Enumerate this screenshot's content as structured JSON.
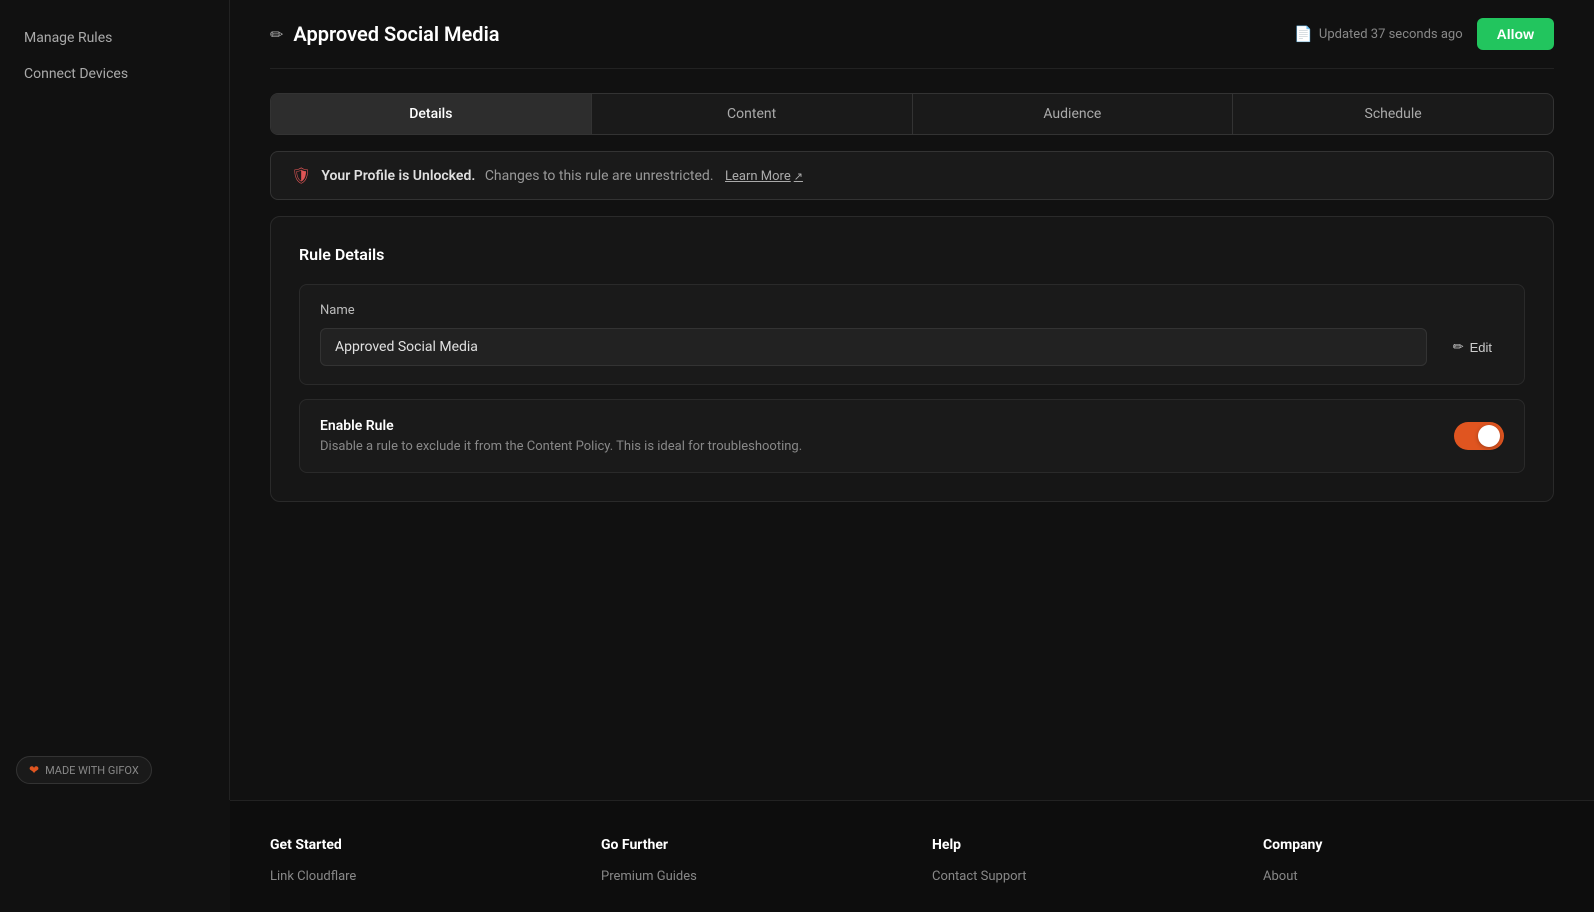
{
  "sidebar": {
    "items": [
      {
        "label": "Manage Rules",
        "id": "manage-rules"
      },
      {
        "label": "Connect Devices",
        "id": "connect-devices"
      }
    ]
  },
  "header": {
    "title": "Approved Social Media",
    "edit_icon": "✏",
    "updated_text": "Updated 37 seconds ago",
    "doc_icon": "📄",
    "allow_button_label": "Allow"
  },
  "tabs": [
    {
      "label": "Details",
      "active": true
    },
    {
      "label": "Content",
      "active": false
    },
    {
      "label": "Audience",
      "active": false
    },
    {
      "label": "Schedule",
      "active": false
    }
  ],
  "banner": {
    "icon": "🛡",
    "bold_text": "Your Profile is Unlocked.",
    "sub_text": "Changes to this rule are unrestricted.",
    "learn_more_label": "Learn More",
    "ext_icon": "↗"
  },
  "rule_details": {
    "section_title": "Rule Details",
    "name_label": "Name",
    "name_value": "Approved Social Media",
    "edit_label": "Edit",
    "edit_icon": "✏",
    "enable_rule_title": "Enable Rule",
    "enable_rule_desc": "Disable a rule to exclude it from the Content Policy. This is ideal for troubleshooting.",
    "toggle_enabled": true
  },
  "footer": {
    "columns": [
      {
        "title": "Get Started",
        "links": [
          "Link Cloudflare"
        ]
      },
      {
        "title": "Go Further",
        "links": [
          "Premium Guides"
        ]
      },
      {
        "title": "Help",
        "links": [
          "Contact Support"
        ]
      },
      {
        "title": "Company",
        "links": [
          "About"
        ]
      }
    ]
  },
  "gifox": {
    "label": "MADE WITH GIFOX"
  }
}
